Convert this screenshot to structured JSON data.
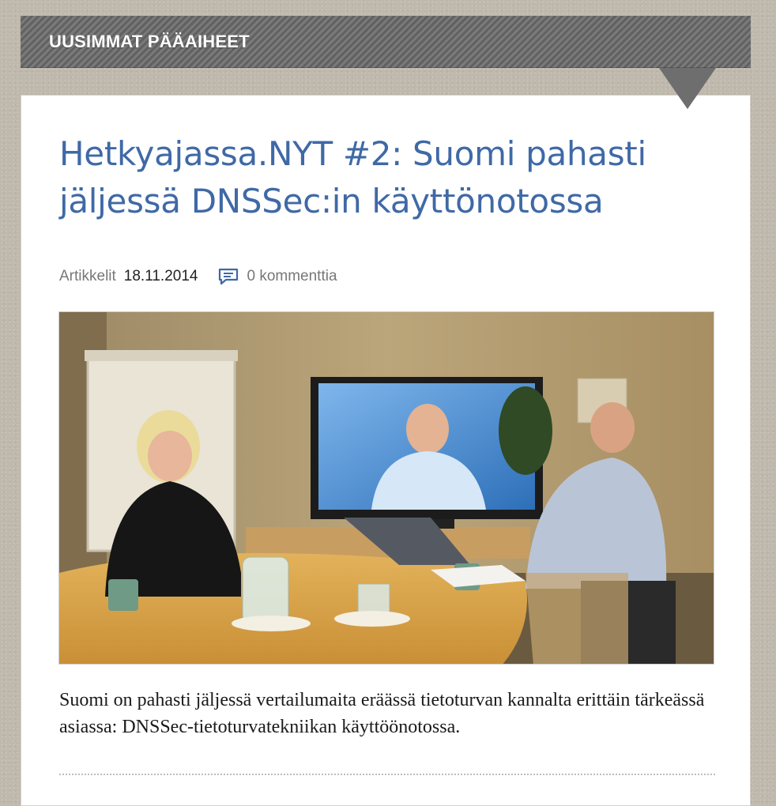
{
  "section": {
    "title": "UUSIMMAT PÄÄAIHEET"
  },
  "article": {
    "title": "Hetkyajassa.NYT #2: Suomi pahasti jäljessä DNSSec:in käyttönotossa",
    "category": "Artikkelit",
    "date": "18.11.2014",
    "comments": "0 kommenttia",
    "excerpt": "Suomi on pahasti jäljessä vertailumaita eräässä tietoturvan kannalta erittäin tärkeässä asiassa: DNSSec-tietoturvatekniikan käyttöönotossa.",
    "image_icon": "photo-meeting-room"
  },
  "colors": {
    "title": "#3f69a6",
    "header_stripe": "#6b6b6b",
    "page_bg": "#bfb8ac",
    "comment_icon": "#3f69a6"
  }
}
